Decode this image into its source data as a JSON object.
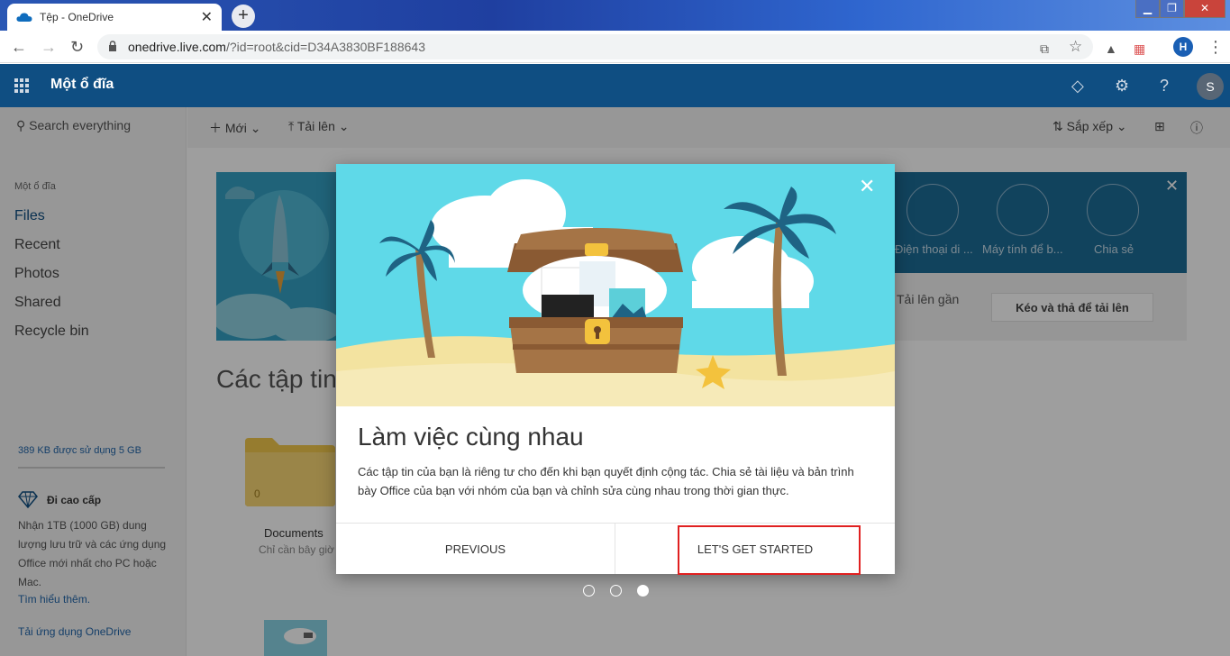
{
  "browser": {
    "tab_title": "Tệp - OneDrive",
    "tab_close": "✕",
    "new_tab": "+",
    "url_host": "onedrive.live.com",
    "url_path": "/?id=root&cid=D34A3830BF188643",
    "profile_initial": "H"
  },
  "header": {
    "app_title": "Một ổ đĩa",
    "user_initial": "S"
  },
  "sidebar": {
    "search_placeholder": "Search everything",
    "section_label": "Một ổ đĩa",
    "items": [
      {
        "label": "Files"
      },
      {
        "label": "Recent"
      },
      {
        "label": "Photos"
      },
      {
        "label": "Shared"
      },
      {
        "label": "Recycle bin"
      }
    ],
    "storage_text": "389 KB được sử dụng 5 GB",
    "premium_title": "Đi cao cấp",
    "premium_desc": "Nhận 1TB (1000 GB) dung lượng lưu trữ và các ứng dụng Office mới nhất cho PC hoặc Mac.",
    "learn_more": "Tìm hiểu thêm.",
    "get_app": "Tải ứng dụng OneDrive"
  },
  "commandbar": {
    "new_label": "Mới",
    "upload_label": "Tải lên",
    "sort_label": "Sắp xếp"
  },
  "background": {
    "devices": [
      {
        "label": "Điện thoại di ..."
      },
      {
        "label": "Máy tính để b..."
      },
      {
        "label": "Chia sẻ"
      }
    ],
    "recent_upload": "Tải lên gần",
    "drop_button": "Kéo và thả để tải lên",
    "files_heading": "Các tập tin",
    "folder_count": "0",
    "folder_name": "Documents",
    "folder_sub": "Chỉ cần bây giờ"
  },
  "dialog": {
    "title": "Làm việc cùng nhau",
    "body": "Các tập tin của bạn là riêng tư cho đến khi bạn quyết định cộng tác. Chia sẻ tài liệu và bản trình bày Office của bạn với nhóm của bạn và chỉnh sửa cùng nhau trong thời gian thực.",
    "previous_label": "PREVIOUS",
    "start_label": "LET'S GET STARTED",
    "close_glyph": "✕"
  },
  "pager": {
    "total": 3,
    "active": 3
  },
  "colors": {
    "header_bg": "#0f4e82",
    "sky": "#5fd9e8",
    "sand": "#f3e3a0",
    "highlight": "#e02020"
  }
}
